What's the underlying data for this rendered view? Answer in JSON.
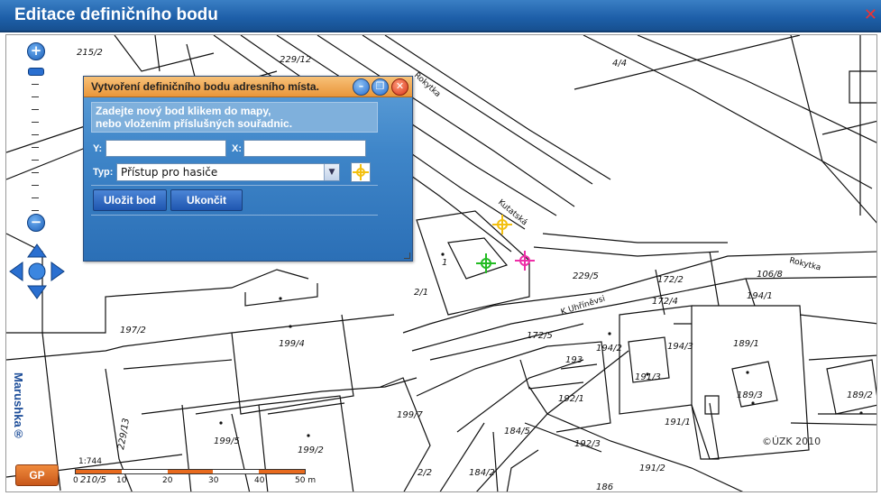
{
  "window": {
    "title": "Editace definičního bodu",
    "close_icon": "close-icon"
  },
  "map": {
    "parcels": [
      "215/2",
      "229/12",
      "4/4",
      "1",
      "2/1",
      "229/5",
      "172/2",
      "172/4",
      "106/8",
      "194/1",
      "197/2",
      "199/4",
      "172/5",
      "194/2",
      "194/3",
      "189/1",
      "193",
      "191/3",
      "189/3",
      "189/2",
      "192/1",
      "191/1",
      "199/7",
      "184/5",
      "192/3",
      "199/5",
      "199/2",
      "229/13",
      "191/2",
      "184/2",
      "2/2",
      "186",
      "210/5"
    ],
    "streets": [
      "Rokytka",
      "Kutatská",
      "K Uhříněvsi",
      "Rokytka"
    ],
    "copyright": "©ÚZK 2010",
    "brand": "Marushka®",
    "logo_text": "GP"
  },
  "scale": {
    "ratio": "1:744",
    "ticks": [
      "0",
      "10",
      "20",
      "30",
      "40",
      "50 m"
    ]
  },
  "dialog": {
    "title": "Vytvoření definičního bodu adresního místa.",
    "hint_line1": "Zadejte nový bod klikem do mapy,",
    "hint_line2": "nebo vložením příslušných souřadnic.",
    "y_label": "Y:",
    "y_value": "",
    "x_label": "X:",
    "x_value": "",
    "type_label": "Typ:",
    "type_value": "Přístup pro hasiče",
    "save_label": "Uložit bod",
    "end_label": "Ukončit"
  },
  "colors": {
    "title_bar": "#1d5ea8",
    "dialog_header": "#e9963a",
    "marker_yellow": "#f3c010",
    "marker_green": "#22bb22",
    "marker_pink": "#ee2fa8",
    "scale_orange": "#e86a1e"
  }
}
